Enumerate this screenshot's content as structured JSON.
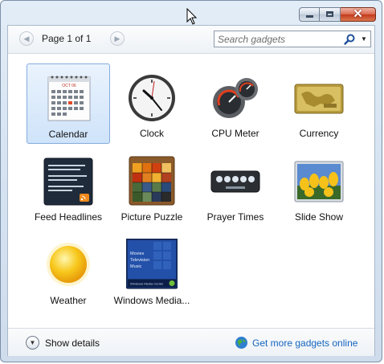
{
  "window": {
    "caption_buttons": {
      "minimize": "minimize",
      "maximize": "maximize",
      "close": "✕"
    }
  },
  "toolbar": {
    "page_label": "Page 1 of 1",
    "prev_icon": "chevron-left-icon",
    "next_icon": "chevron-right-icon",
    "search_placeholder": "Search gadgets",
    "search_value": ""
  },
  "gadgets": [
    {
      "label": "Calendar",
      "icon": "calendar-icon",
      "selected": true
    },
    {
      "label": "Clock",
      "icon": "clock-icon",
      "selected": false
    },
    {
      "label": "CPU Meter",
      "icon": "cpu-meter-icon",
      "selected": false
    },
    {
      "label": "Currency",
      "icon": "currency-icon",
      "selected": false
    },
    {
      "label": "Feed Headlines",
      "icon": "feed-headlines-icon",
      "selected": false
    },
    {
      "label": "Picture Puzzle",
      "icon": "picture-puzzle-icon",
      "selected": false
    },
    {
      "label": "Prayer Times",
      "icon": "prayer-times-icon",
      "selected": false
    },
    {
      "label": "Slide Show",
      "icon": "slide-show-icon",
      "selected": false
    },
    {
      "label": "Weather",
      "icon": "weather-icon",
      "selected": false
    },
    {
      "label": "Windows Media...",
      "icon": "windows-media-icon",
      "selected": false
    }
  ],
  "calendar_thumb": {
    "month": "OCT 06"
  },
  "media_thumb": {
    "lines": [
      "Movies",
      "Television",
      "Music"
    ],
    "footer": "Windows Media Center"
  },
  "footer": {
    "details_label": "Show details",
    "more_link": "Get more gadgets online"
  },
  "colors": {
    "accent_link": "#1565c0",
    "selection_border": "#84acdd",
    "close_button": "#c33a1c"
  }
}
